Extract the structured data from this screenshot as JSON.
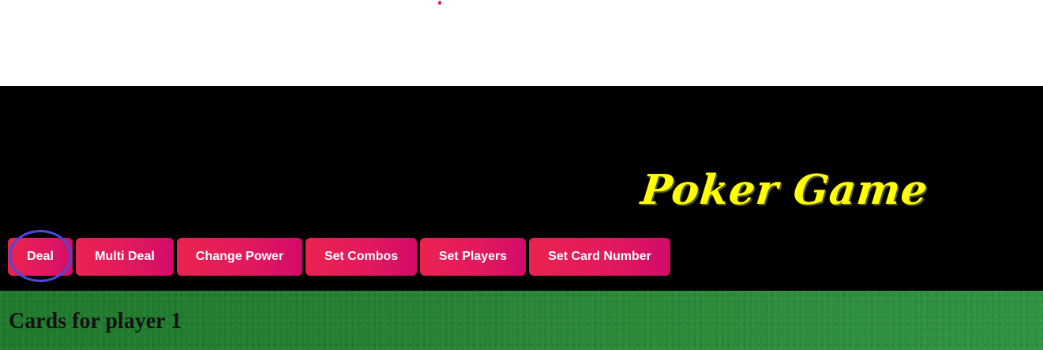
{
  "header": {
    "title": "Poker Game",
    "title_color": "#ffff00",
    "background_color": "#000000"
  },
  "toolbar": {
    "buttons": [
      {
        "label": "Deal",
        "highlighted": true
      },
      {
        "label": "Multi Deal"
      },
      {
        "label": "Change Power"
      },
      {
        "label": "Set Combos"
      },
      {
        "label": "Set Players"
      },
      {
        "label": "Set Card Number"
      }
    ],
    "button_color": "#e61f5a",
    "highlight_color": "#4a4ad8"
  },
  "table": {
    "felt_color": "#2a8a36",
    "player_heading": "Cards for player 1"
  }
}
